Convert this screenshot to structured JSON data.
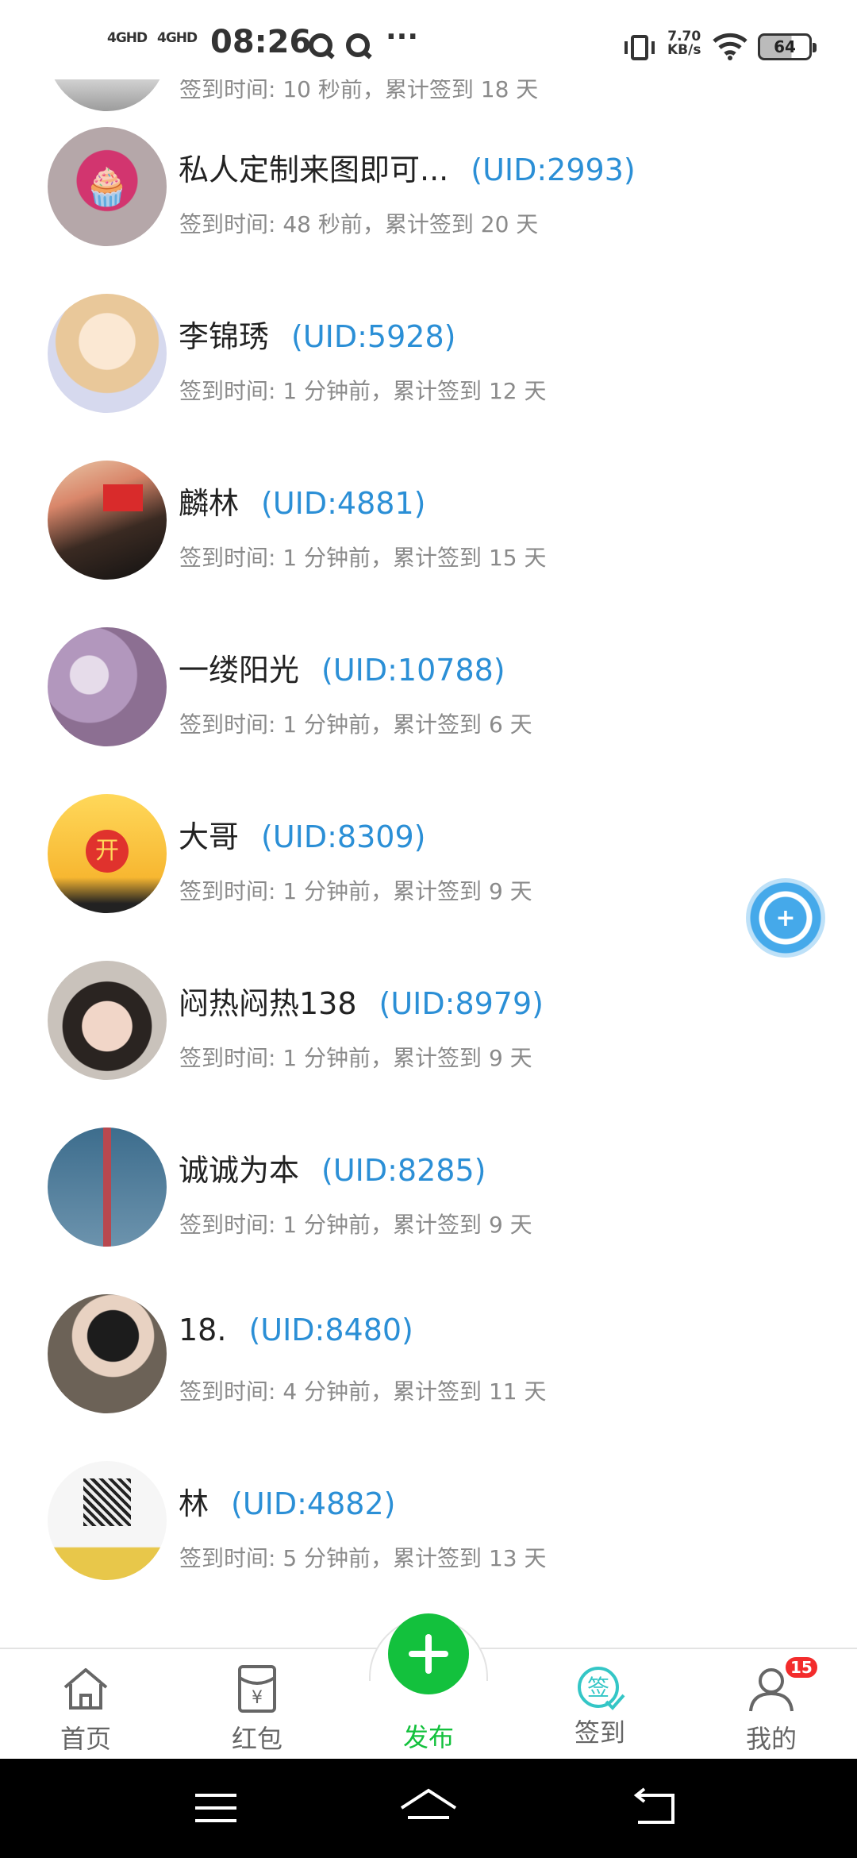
{
  "status_bar": {
    "signal1": "4GHD",
    "signal2": "4GHD",
    "time": "08:26",
    "more": "···",
    "speed_value": "7.70",
    "speed_unit": "KB/s",
    "battery": "64"
  },
  "checkins": [
    {
      "name": "",
      "uid": "",
      "meta": "签到时间: 10 秒前，累计签到 18 天",
      "avatar_color": "#c9b7ae"
    },
    {
      "name": "私人定制来图即可...",
      "uid": "(UID:2993)",
      "meta": "签到时间: 48 秒前，累计签到 20 天",
      "avatar_color": "#d9b3b8",
      "avatar_glyph": "🧁"
    },
    {
      "name": "李锦琇",
      "uid": "(UID:5928)",
      "meta": "签到时间: 1 分钟前，累计签到 12 天",
      "avatar_color": "#f2e2cf"
    },
    {
      "name": "麟林",
      "uid": "(UID:4881)",
      "meta": "签到时间: 1 分钟前，累计签到 15 天",
      "avatar_color": "#7a5b4b"
    },
    {
      "name": "一缕阳光",
      "uid": "(UID:10788)",
      "meta": "签到时间: 1 分钟前，累计签到 6 天",
      "avatar_color": "#b89fb9"
    },
    {
      "name": "大哥",
      "uid": "(UID:8309)",
      "meta": "签到时间: 1 分钟前，累计签到 9 天",
      "avatar_color": "#f5c842",
      "avatar_glyph": "开"
    },
    {
      "name": "闷热闷热138",
      "uid": "(UID:8979)",
      "meta": "签到时间: 1 分钟前，累计签到 9 天",
      "avatar_color": "#c7b4a6"
    },
    {
      "name": "诚诚为本",
      "uid": "(UID:8285)",
      "meta": "签到时间: 1 分钟前，累计签到 9 天",
      "avatar_color": "#5a7f9a"
    },
    {
      "name": "18.",
      "uid": "(UID:8480)",
      "meta": "签到时间: 4 分钟前，累计签到 11 天",
      "avatar_color": "#6e6a63"
    },
    {
      "name": "林",
      "uid": "(UID:4882)",
      "meta": "签到时间: 5 分钟前，累计签到 13 天",
      "avatar_color": "#f3f0e6"
    }
  ],
  "tabs": {
    "home": "首页",
    "redpacket": "红包",
    "publish": "发布",
    "checkin": "签到",
    "mine": "我的",
    "mine_badge": "15",
    "redpacket_symbol": "¥",
    "checkin_symbol": "签"
  },
  "colors": {
    "accent_green": "#13c13d",
    "uid_blue": "#2b8fd6",
    "checkin_teal": "#34c6c6"
  }
}
